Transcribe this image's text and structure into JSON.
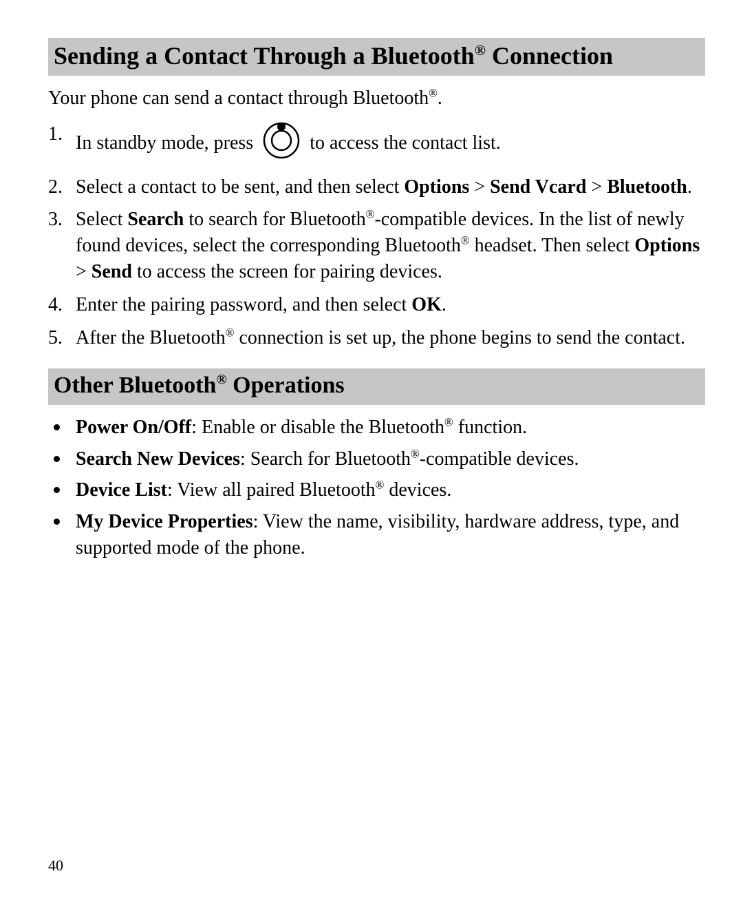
{
  "section1": {
    "heading_pre": "Sending a Contact Through a Bluetooth",
    "heading_post": " Connection",
    "intro_pre": "Your phone can send a contact through Bluetooth",
    "intro_post": ".",
    "steps": {
      "s1": {
        "pre": "In standby mode, press ",
        "post": " to access the contact list."
      },
      "s2": {
        "pre": "Select a contact to be sent, and then select ",
        "b1": "Options",
        "gt1": " > ",
        "b2": "Send Vcard",
        "gt2": " > ",
        "b3": "Bluetooth",
        "post": "."
      },
      "s3": {
        "pre": "Select ",
        "b1": "Search",
        "mid1": " to search for Bluetooth",
        "mid2": "-compatible devices. In the list of newly found devices, select the corresponding Bluetooth",
        "mid3": " headset. Then select ",
        "b2": "Options",
        "gt": " > ",
        "b3": "Send",
        "post": " to access the screen for pairing devices."
      },
      "s4": {
        "pre": "Enter the pairing password, and then select ",
        "b1": "OK",
        "post": "."
      },
      "s5": {
        "pre": "After the Bluetooth",
        "post": " connection is set up, the phone begins to send the contact."
      }
    }
  },
  "section2": {
    "heading_pre": "Other Bluetooth",
    "heading_post": " Operations",
    "items": {
      "i1": {
        "label": "Power On/Off",
        "desc_pre": ": Enable or disable the Bluetooth",
        "desc_post": " function."
      },
      "i2": {
        "label": "Search New Devices",
        "desc_pre": ": Search for Bluetooth",
        "desc_post": "-compatible devices."
      },
      "i3": {
        "label": "Device List",
        "desc_pre": ": View all paired Bluetooth",
        "desc_post": " devices."
      },
      "i4": {
        "label": "My Device Properties",
        "desc": ": View the name, visibility, hardware address, type, and supported mode of the phone."
      }
    }
  },
  "reg": "®",
  "page_number": "40"
}
